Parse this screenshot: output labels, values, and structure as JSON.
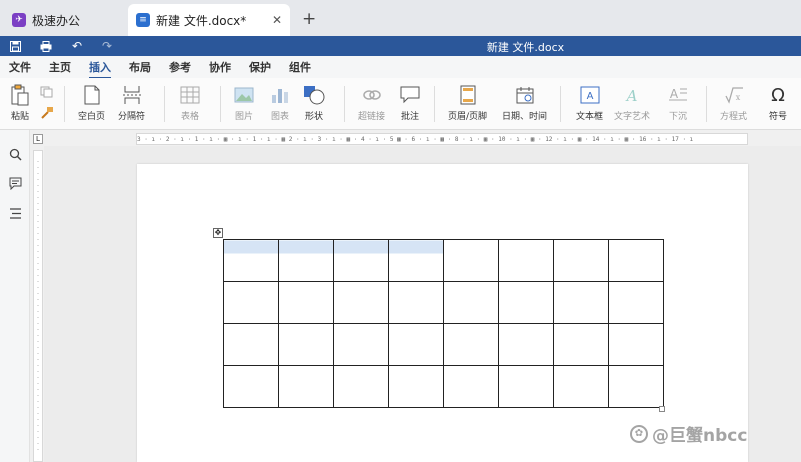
{
  "tabs": [
    {
      "label": "极速办公",
      "icon": "app-logo-icon"
    },
    {
      "label": "新建 文件.docx*",
      "icon": "document-icon"
    }
  ],
  "quickbar": {
    "title": "新建 文件.docx"
  },
  "menu": [
    "文件",
    "主页",
    "插入",
    "布局",
    "参考",
    "协作",
    "保护",
    "组件"
  ],
  "menu_active": "插入",
  "ribbon": {
    "paste": "粘贴",
    "blank_page": "空白页",
    "separator": "分隔符",
    "table": "表格",
    "image": "图片",
    "chart": "图表",
    "shape": "形状",
    "hyperlink": "超链接",
    "comment": "批注",
    "header_footer": "页眉/页脚",
    "datetime": "日期、时间",
    "textbox": "文本框",
    "wordart": "文字艺术",
    "dropcap": "下沉",
    "equation": "方程式",
    "symbol": "符号"
  },
  "ruler": {
    "h_text": "3 · ı · 2 · ı · 1 · ı · ▦ · ı · 1 · ı · ▦ 2 · ı · 3 · ı · ▦ · 4 · ı · 5 ▦ · 6 · ı · ▦ · 8 · ı · ▦ · 10 · ı · ▦ · 12 · ı · ▦ · 14 · ı · ▦ · 16 · ı · 17 · ı",
    "corner": "L"
  },
  "table": {
    "rows": 4,
    "cols": 8,
    "selected_cells": 4
  },
  "watermark": "@巨蟹nbcc",
  "colors": {
    "accent": "#2b579a",
    "selection": "#d6e4f5"
  }
}
